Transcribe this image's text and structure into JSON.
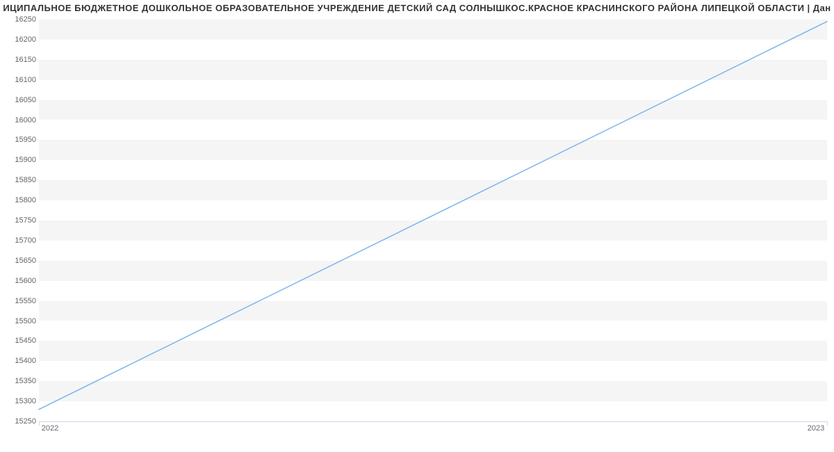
{
  "title": "ИЦИПАЛЬНОЕ БЮДЖЕТНОЕ ДОШКОЛЬНОЕ ОБРАЗОВАТЕЛЬНОЕ УЧРЕЖДЕНИЕ ДЕТСКИЙ САД СОЛНЫШКОС.КРАСНОЕ КРАСНИНСКОГО РАЙОНА ЛИПЕЦКОЙ ОБЛАСТИ | Дан",
  "chart_data": {
    "type": "line",
    "x": [
      2022,
      2023
    ],
    "values": [
      15280,
      16245
    ],
    "title": "ИЦИПАЛЬНОЕ БЮДЖЕТНОЕ ДОШКОЛЬНОЕ ОБРАЗОВАТЕЛЬНОЕ УЧРЕЖДЕНИЕ ДЕТСКИЙ САД СОЛНЫШКОС.КРАСНОЕ КРАСНИНСКОГО РАЙОНА ЛИПЕЦКОЙ ОБЛАСТИ | Дан",
    "xlabel": "",
    "ylabel": "",
    "xlim": [
      2022,
      2023
    ],
    "ylim": [
      15250,
      16250
    ],
    "y_ticks": [
      15250,
      15300,
      15350,
      15400,
      15450,
      15500,
      15550,
      15600,
      15650,
      15700,
      15750,
      15800,
      15850,
      15900,
      15950,
      16000,
      16050,
      16100,
      16150,
      16200,
      16250
    ],
    "x_ticks": [
      2022,
      2023
    ],
    "line_color": "#7cb5ec",
    "grid": true
  },
  "y_labels": {
    "t0": "15250",
    "t1": "15300",
    "t2": "15350",
    "t3": "15400",
    "t4": "15450",
    "t5": "15500",
    "t6": "15550",
    "t7": "15600",
    "t8": "15650",
    "t9": "15700",
    "t10": "15750",
    "t11": "15800",
    "t12": "15850",
    "t13": "15900",
    "t14": "15950",
    "t15": "16000",
    "t16": "16050",
    "t17": "16100",
    "t18": "16150",
    "t19": "16200",
    "t20": "16250"
  },
  "x_labels": {
    "x0": "2022",
    "x1": "2023"
  }
}
